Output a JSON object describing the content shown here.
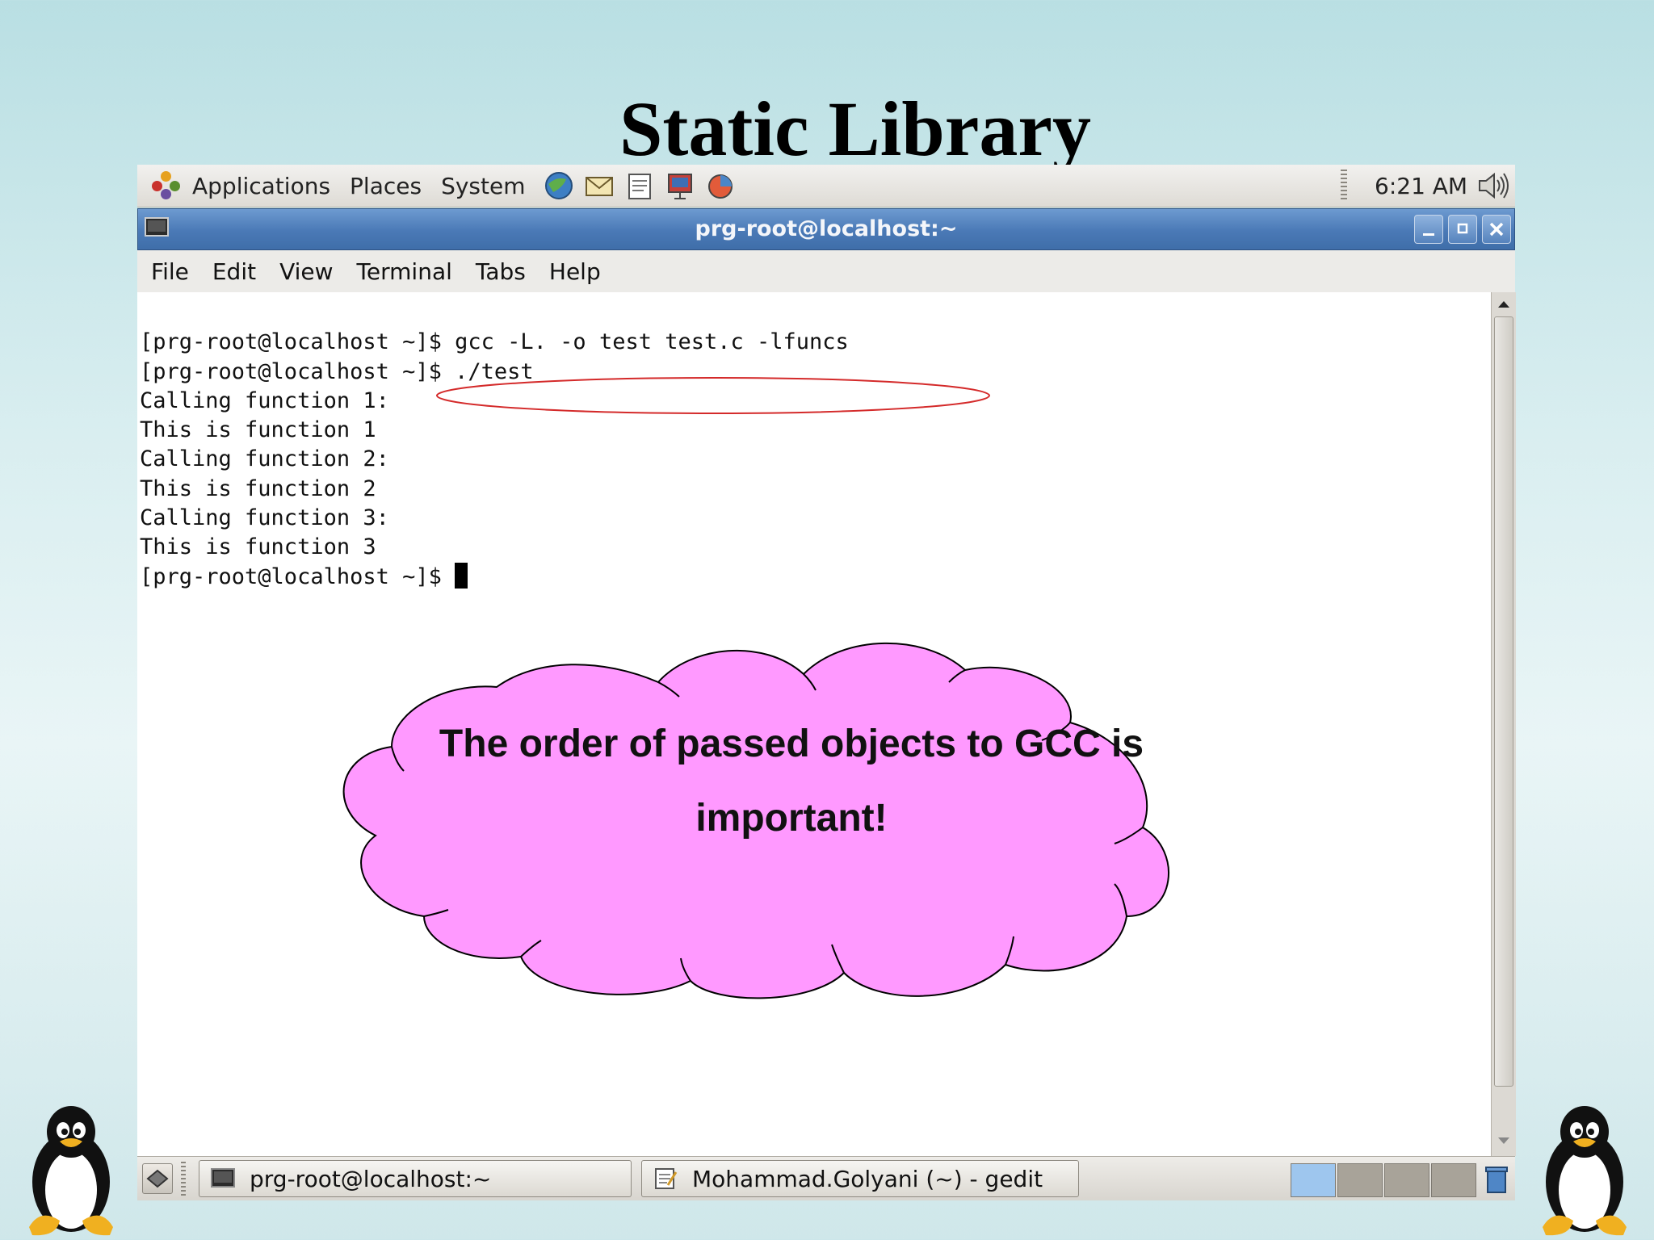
{
  "slide": {
    "title": "Static Library"
  },
  "top_panel": {
    "menus": [
      "Applications",
      "Places",
      "System"
    ],
    "launchers": [
      "browser-icon",
      "email-icon",
      "text-editor-icon",
      "presentation-icon",
      "office-icon"
    ],
    "clock": "6:21 AM",
    "volume_icon": "speaker-icon"
  },
  "window": {
    "title": "prg-root@localhost:~",
    "menu": [
      "File",
      "Edit",
      "View",
      "Terminal",
      "Tabs",
      "Help"
    ],
    "buttons": [
      "minimize",
      "maximize",
      "close"
    ]
  },
  "terminal": {
    "lines": [
      "[prg-root@localhost ~]$ gcc -L. -o test test.c -lfuncs",
      "[prg-root@localhost ~]$ ./test",
      "Calling function 1:",
      "This is function 1",
      "Calling function 2:",
      "This is function 2",
      "Calling function 3:",
      "This is function 3",
      "[prg-root@localhost ~]$ "
    ],
    "highlight_color": "#d42a2a"
  },
  "callout": {
    "line1": "The order of passed objects to GCC is",
    "line2": "important!",
    "fill": "#ff99ff"
  },
  "taskbar": {
    "tasks": [
      "prg-root@localhost:~",
      "Mohammad.Golyani (~) - gedit"
    ]
  }
}
